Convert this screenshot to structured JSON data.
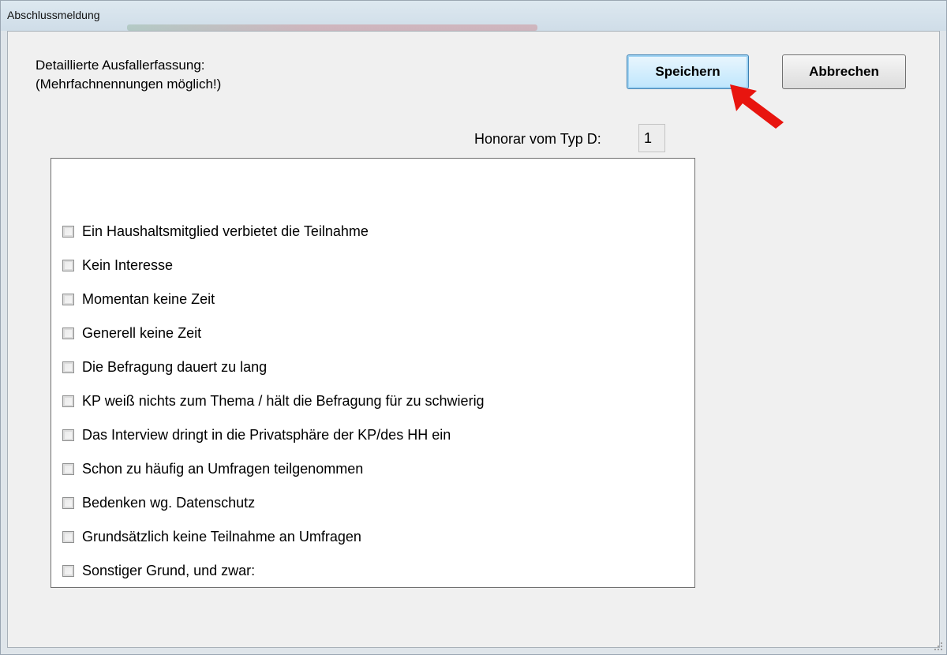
{
  "window": {
    "title": "Abschlussmeldung"
  },
  "header": {
    "instruction_line1": "Detaillierte Ausfallerfassung:",
    "instruction_line2": "(Mehrfachnennungen möglich!)"
  },
  "buttons": {
    "save_label": "Speichern",
    "cancel_label": "Abbrechen"
  },
  "honorar": {
    "label": "Honorar vom Typ D:",
    "value": "1"
  },
  "reasons": [
    {
      "label": "Ein Haushaltsmitglied verbietet die Teilnahme",
      "checked": false
    },
    {
      "label": "Kein Interesse",
      "checked": false
    },
    {
      "label": "Momentan keine Zeit",
      "checked": false
    },
    {
      "label": "Generell keine Zeit",
      "checked": false
    },
    {
      "label": "Die Befragung dauert zu lang",
      "checked": false
    },
    {
      "label": "KP weiß nichts zum Thema / hält die  Befragung für zu schwierig",
      "checked": false
    },
    {
      "label": "Das Interview dringt in die Privatsphäre der KP/des HH ein",
      "checked": false
    },
    {
      "label": "Schon zu häufig an Umfragen teilgenommen",
      "checked": false
    },
    {
      "label": "Bedenken wg. Datenschutz",
      "checked": false
    },
    {
      "label": "Grundsätzlich keine Teilnahme an Umfragen",
      "checked": false
    },
    {
      "label": "Sonstiger Grund, und zwar:",
      "checked": false
    }
  ],
  "colors": {
    "arrow": "#e8150f",
    "save_button_highlight": "#bee6fd"
  },
  "icons": {
    "annotation": "red-arrow-icon",
    "resize": "resize-grip-icon"
  }
}
